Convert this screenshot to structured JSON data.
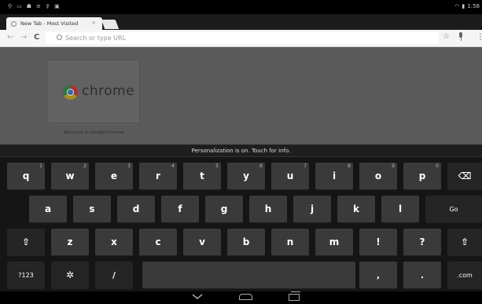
{
  "status_bar": {
    "left_icons": [
      "usb-icon",
      "notification-icon",
      "android-icon",
      "sync-icon",
      "usb-icon",
      "image-icon"
    ],
    "time": "1:58"
  },
  "tab": {
    "title": "New Tab - Most Visited"
  },
  "omnibox": {
    "placeholder": "Search or type URL"
  },
  "page": {
    "thumbnail_logo_text": "chrome",
    "thumbnail_label": "Welcome to Google Chrome"
  },
  "keyboard": {
    "suggestion_text": "Personalization is on. Touch for info.",
    "row1": [
      {
        "label": "q",
        "hint": "1"
      },
      {
        "label": "w",
        "hint": "2"
      },
      {
        "label": "e",
        "hint": "3"
      },
      {
        "label": "r",
        "hint": "4"
      },
      {
        "label": "t",
        "hint": "5"
      },
      {
        "label": "y",
        "hint": "6"
      },
      {
        "label": "u",
        "hint": "7"
      },
      {
        "label": "i",
        "hint": "8"
      },
      {
        "label": "o",
        "hint": "9"
      },
      {
        "label": "p",
        "hint": "0"
      }
    ],
    "row2": [
      "a",
      "s",
      "d",
      "f",
      "g",
      "h",
      "j",
      "k",
      "l"
    ],
    "row3": [
      "z",
      "x",
      "c",
      "v",
      "b",
      "n",
      "m",
      "!",
      "?"
    ],
    "go_label": "Go",
    "mode_label": "?123",
    "slash_label": "/",
    "comma_label": ",",
    "period_label": ".",
    "dotcom_label": ".com"
  }
}
